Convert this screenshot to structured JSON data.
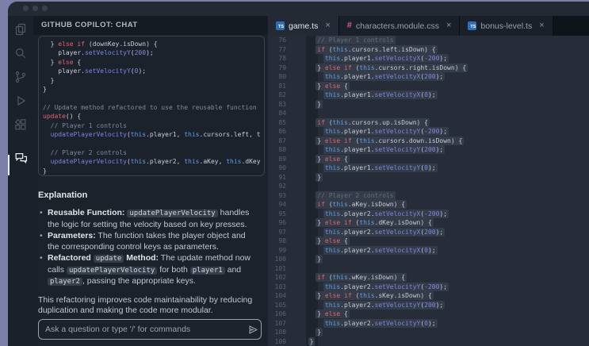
{
  "chat": {
    "header": "GITHUB COPILOT: CHAT",
    "code_lines": [
      "  } else if (downKey.isDown) {",
      "    player.setVelocityY(200);",
      "  } else {",
      "    player.setVelocityY(0);",
      "  }",
      "}",
      "",
      "// Update method refactored to use the reusable function",
      "update() {",
      "  // Player 1 controls",
      "  updatePlayerVelocity(this.player1, this.cursors.left, t",
      "",
      "  // Player 2 controls",
      "  updatePlayerVelocity(this.player2, this.aKey, this.dKey",
      "}"
    ],
    "explanation": {
      "heading": "Explanation",
      "bullets": [
        [
          {
            "t": "Reusable Function:",
            "b": 1
          },
          {
            "t": " "
          },
          {
            "t": "updatePlayerVelocity",
            "c": 1
          },
          {
            "t": " handles the logic for setting the velocity based on key presses."
          }
        ],
        [
          {
            "t": "Parameters:",
            "b": 1
          },
          {
            "t": " The function takes the player object and the corresponding control keys as parameters."
          }
        ],
        [
          {
            "t": "Refactored",
            "b": 1
          },
          {
            "t": " "
          },
          {
            "t": "update",
            "c": 1
          },
          {
            "t": " "
          },
          {
            "t": "Method:",
            "b": 1
          },
          {
            "t": " The update method now calls "
          },
          {
            "t": "updatePlayerVelocity",
            "c": 1
          },
          {
            "t": " for both "
          },
          {
            "t": "player1",
            "c": 1
          },
          {
            "t": " and "
          },
          {
            "t": "player2",
            "c": 1
          },
          {
            "t": ", passing the appropriate keys."
          }
        ]
      ],
      "closing": "This refactoring improves code maintainability by reducing duplication and making the code more modular."
    },
    "input": {
      "placeholder": "Ask a question or type '/' for commands"
    }
  },
  "activity_bar": {
    "items": [
      {
        "name": "files"
      },
      {
        "name": "search"
      },
      {
        "name": "source-control"
      },
      {
        "name": "run-debug"
      },
      {
        "name": "extensions"
      },
      {
        "name": "copilot-chat",
        "active": true
      }
    ]
  },
  "editor": {
    "tabs": [
      {
        "label": "game.ts",
        "icon": "ts",
        "active": true,
        "close": "×"
      },
      {
        "label": "characters.module.css",
        "icon": "css",
        "active": false,
        "close": "×"
      },
      {
        "label": "bonus-level.ts",
        "icon": "ts",
        "active": false,
        "close": "×"
      }
    ],
    "ts_icon_text": "TS",
    "css_icon_text": "#",
    "lines": [
      {
        "n": 76,
        "c": "    // Player 1 controls"
      },
      {
        "n": 77,
        "c": "    if (this.cursors.left.isDown) {"
      },
      {
        "n": 78,
        "c": "      this.player1.setVelocityX(-200);"
      },
      {
        "n": 79,
        "c": "    } else if (this.cursors.right.isDown) {"
      },
      {
        "n": 80,
        "c": "      this.player1.setVelocityX(200);"
      },
      {
        "n": 81,
        "c": "    } else {"
      },
      {
        "n": 82,
        "c": "      this.player1.setVelocityX(0);"
      },
      {
        "n": 83,
        "c": "    }"
      },
      {
        "n": 84,
        "c": ""
      },
      {
        "n": 85,
        "c": "    if (this.cursors.up.isDown) {"
      },
      {
        "n": 86,
        "c": "      this.player1.setVelocityY(-200);"
      },
      {
        "n": 87,
        "c": "    } else if (this.cursors.down.isDown) {"
      },
      {
        "n": 88,
        "c": "      this.player1.setVelocityY(200);"
      },
      {
        "n": 89,
        "c": "    } else {"
      },
      {
        "n": 90,
        "c": "      this.player1.setVelocityY(0);"
      },
      {
        "n": 91,
        "c": "    }"
      },
      {
        "n": 92,
        "c": ""
      },
      {
        "n": 93,
        "c": "    // Player 2 controls"
      },
      {
        "n": 94,
        "c": "    if (this.aKey.isDown) {"
      },
      {
        "n": 95,
        "c": "      this.player2.setVelocityX(-200);"
      },
      {
        "n": 96,
        "c": "    } else if (this.dKey.isDown) {"
      },
      {
        "n": 97,
        "c": "      this.player2.setVelocityX(200);"
      },
      {
        "n": 98,
        "c": "    } else {"
      },
      {
        "n": 99,
        "c": "      this.player2.setVelocityX(0);"
      },
      {
        "n": 100,
        "c": "    }"
      },
      {
        "n": 101,
        "c": ""
      },
      {
        "n": 102,
        "c": "    if (this.wKey.isDown) {"
      },
      {
        "n": 103,
        "c": "      this.player2.setVelocityY(-200);"
      },
      {
        "n": 104,
        "c": "    } else if (this.sKey.isDown) {"
      },
      {
        "n": 105,
        "c": "      this.player2.setVelocityY(200);"
      },
      {
        "n": 106,
        "c": "    } else {"
      },
      {
        "n": 107,
        "c": "      this.player2.setVelocityY(0);"
      },
      {
        "n": 108,
        "c": "    }"
      },
      {
        "n": 109,
        "c": "  }"
      }
    ]
  },
  "colors": {
    "frame_purple": "#7c7fa8",
    "window_bg": "#1c222c",
    "editor_bg": "#272d38",
    "keyword": "#e0646e",
    "function": "#7d86dc",
    "this_kw": "#5f9ee6",
    "number": "#8289e0",
    "comment": "#646e7d",
    "ts_icon_blue": "#2f6fb5",
    "css_icon_pink": "#cf5ba0"
  }
}
